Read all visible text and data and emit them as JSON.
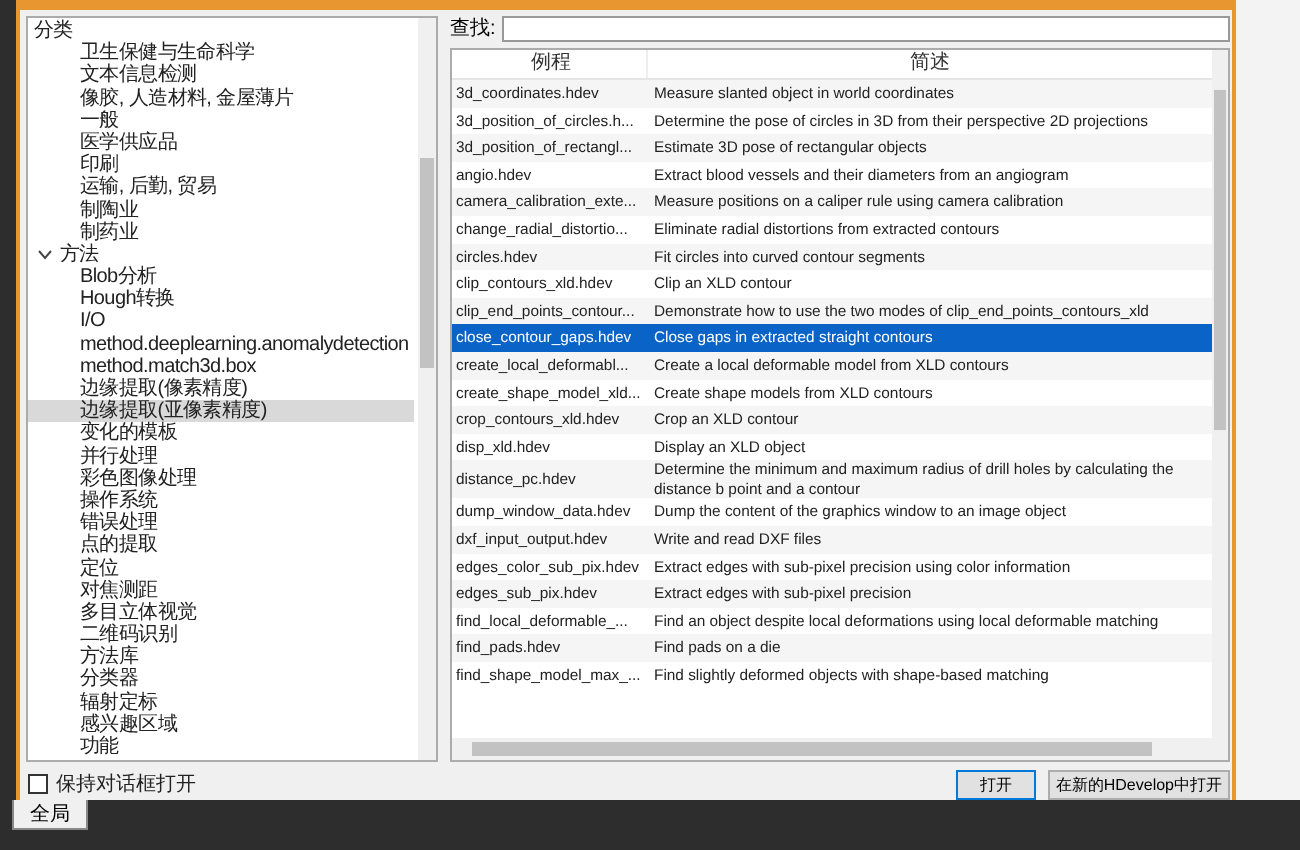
{
  "tree": {
    "items": [
      {
        "label": "分类",
        "expanded": true,
        "selected": false,
        "children": [
          {
            "label": "卫生保健与生命科学",
            "selected": false
          },
          {
            "label": "文本信息检测",
            "selected": false
          },
          {
            "label": "像胶, 人造材料, 金屋薄片",
            "selected": false
          },
          {
            "label": "一般",
            "selected": false
          },
          {
            "label": "医学供应品",
            "selected": false
          },
          {
            "label": "印刷",
            "selected": false
          },
          {
            "label": "运输, 后勤, 贸易",
            "selected": false
          },
          {
            "label": "制陶业",
            "selected": false
          },
          {
            "label": "制药业",
            "selected": false
          }
        ]
      },
      {
        "label": "方法",
        "expanded": true,
        "selected": false,
        "children": [
          {
            "label": "Blob分析",
            "selected": false
          },
          {
            "label": "Hough转换",
            "selected": false
          },
          {
            "label": "I/O",
            "selected": false
          },
          {
            "label": "method.deeplearning.anomalydetection",
            "selected": false
          },
          {
            "label": "method.match3d.box",
            "selected": false
          },
          {
            "label": "边缘提取(像素精度)",
            "selected": false
          },
          {
            "label": "边缘提取(亚像素精度)",
            "selected": true
          },
          {
            "label": "变化的模板",
            "selected": false
          },
          {
            "label": "并行处理",
            "selected": false
          },
          {
            "label": "彩色图像处理",
            "selected": false
          },
          {
            "label": "操作系统",
            "selected": false
          },
          {
            "label": "错误处理",
            "selected": false
          },
          {
            "label": "点的提取",
            "selected": false
          },
          {
            "label": "定位",
            "selected": false
          },
          {
            "label": "对焦测距",
            "selected": false
          },
          {
            "label": "多目立体视觉",
            "selected": false
          },
          {
            "label": "二维码识别",
            "selected": false
          },
          {
            "label": "方法库",
            "selected": false
          },
          {
            "label": "分类器",
            "selected": false
          },
          {
            "label": "辐射定标",
            "selected": false
          },
          {
            "label": "感兴趣区域",
            "selected": false
          },
          {
            "label": "功能",
            "selected": false
          }
        ]
      }
    ]
  },
  "keep_open": {
    "label": "保持对话框打开",
    "checked": false
  },
  "search": {
    "label": "查找:"
  },
  "table": {
    "columns": [
      "例程",
      "简述"
    ],
    "rows": [
      {
        "cells": [
          "3d_coordinates.hdev",
          "Measure slanted object in world coordinates"
        ],
        "selected": false
      },
      {
        "cells": [
          "3d_position_of_circles.h...",
          "Determine the pose of circles in 3D from their perspective 2D projections"
        ],
        "selected": false
      },
      {
        "cells": [
          "3d_position_of_rectangl...",
          "Estimate 3D pose of rectangular objects"
        ],
        "selected": false
      },
      {
        "cells": [
          "angio.hdev",
          "Extract blood vessels and their diameters from an angiogram"
        ],
        "selected": false
      },
      {
        "cells": [
          "camera_calibration_exte...",
          "Measure positions on a caliper rule using camera calibration"
        ],
        "selected": false
      },
      {
        "cells": [
          "change_radial_distortio...",
          "Eliminate radial distortions from extracted contours"
        ],
        "selected": false
      },
      {
        "cells": [
          "circles.hdev",
          "Fit circles into curved contour segments"
        ],
        "selected": false
      },
      {
        "cells": [
          "clip_contours_xld.hdev",
          "Clip an XLD contour"
        ],
        "selected": false
      },
      {
        "cells": [
          "clip_end_points_contour...",
          "Demonstrate how to use the two modes of clip_end_points_contours_xld"
        ],
        "selected": false
      },
      {
        "cells": [
          "close_contour_gaps.hdev",
          "Close gaps in extracted straight contours"
        ],
        "selected": true
      },
      {
        "cells": [
          "create_local_deformabl...",
          "Create a local deformable model from XLD contours"
        ],
        "selected": false
      },
      {
        "cells": [
          "create_shape_model_xld...",
          "Create shape models from XLD contours"
        ],
        "selected": false
      },
      {
        "cells": [
          "crop_contours_xld.hdev",
          "Crop an XLD contour"
        ],
        "selected": false
      },
      {
        "cells": [
          "disp_xld.hdev",
          "Display an XLD object"
        ],
        "selected": false
      },
      {
        "cells": [
          "distance_pc.hdev",
          "Determine the minimum and maximum radius of drill holes by calculating the distance b point and a contour"
        ],
        "selected": false
      },
      {
        "cells": [
          "dump_window_data.hdev",
          "Dump the content of the graphics window to an image object"
        ],
        "selected": false
      },
      {
        "cells": [
          "dxf_input_output.hdev",
          "Write and read DXF files"
        ],
        "selected": false
      },
      {
        "cells": [
          "edges_color_sub_pix.hdev",
          "Extract edges with sub-pixel precision using color information"
        ],
        "selected": false
      },
      {
        "cells": [
          "edges_sub_pix.hdev",
          "Extract edges with sub-pixel precision"
        ],
        "selected": false
      },
      {
        "cells": [
          "find_local_deformable_...",
          "Find an object despite local deformations using local deformable matching"
        ],
        "selected": false
      },
      {
        "cells": [
          "find_pads.hdev",
          "Find pads on a die"
        ],
        "selected": false
      },
      {
        "cells": [
          "find_shape_model_max_...",
          "Find slightly deformed objects with shape-based matching"
        ],
        "selected": false
      }
    ]
  },
  "buttons": [
    {
      "label": "打开",
      "kind": "default"
    },
    {
      "label": "在新的HDevelop中打开",
      "kind": "normal"
    }
  ],
  "background_tab": {
    "label": "全局"
  }
}
